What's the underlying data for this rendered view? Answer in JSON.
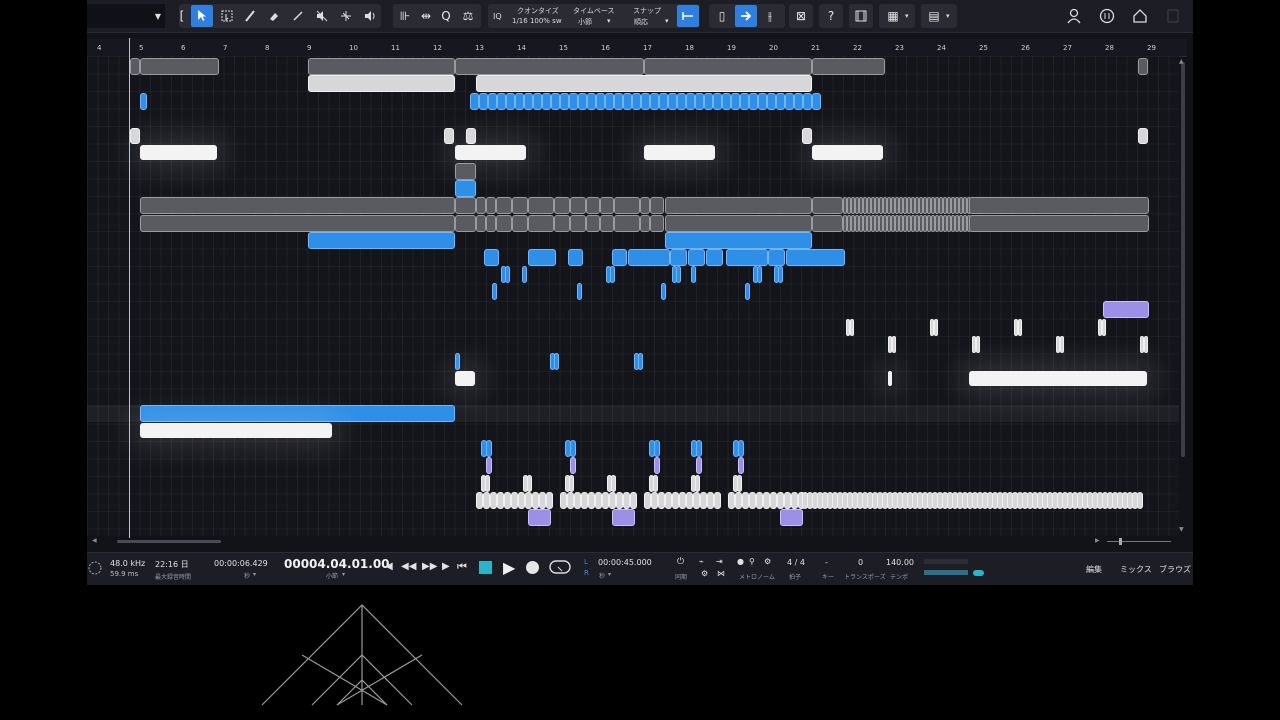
{
  "toolbar": {
    "quantize_label": "クオンタイズ",
    "quantize_value": "1/16 100% sw",
    "timebase_label": "タイムベース",
    "timebase_value": "小節",
    "snap_label": "スナップ",
    "snap_value": "順応",
    "iq": "IQ",
    "help": "?"
  },
  "ruler": {
    "bars": [
      "4",
      "5",
      "6",
      "7",
      "8",
      "9",
      "10",
      "11",
      "12",
      "13",
      "14",
      "15",
      "16",
      "17",
      "18",
      "19",
      "20",
      "21",
      "22",
      "23",
      "24",
      "25",
      "26",
      "27",
      "28",
      "29"
    ]
  },
  "transport": {
    "sample_rate": "48.0 kHz",
    "latency": "59.9 ms",
    "record_max": "22:16 日",
    "record_max_label": "最大録音時間",
    "time_seconds": "00:00:06.429",
    "time_seconds_unit": "秒",
    "position": "00004.04.01.00",
    "position_unit": "小節",
    "loop_time": "00:00:45.000",
    "loop_unit": "秒",
    "sync_label": "同期",
    "metronome_label": "メトロノーム",
    "signature": "4 / 4",
    "signature_label": "拍子",
    "key": "-",
    "key_label": "キー",
    "transpose": "0",
    "transpose_label": "トランスポーズ",
    "tempo": "140.00",
    "tempo_label": "テンポ",
    "tab_edit": "編集",
    "tab_mix": "ミックス",
    "tab_browse": "ブラウズ",
    "loop_l": "L",
    "loop_r": "R"
  },
  "colors": {
    "accent": "#2f7fe0",
    "clip_blue": "#2f8fe6",
    "clip_purple": "#9c8fe6",
    "clip_gray": "#5a5b60",
    "clip_white": "#f3f3f3"
  }
}
